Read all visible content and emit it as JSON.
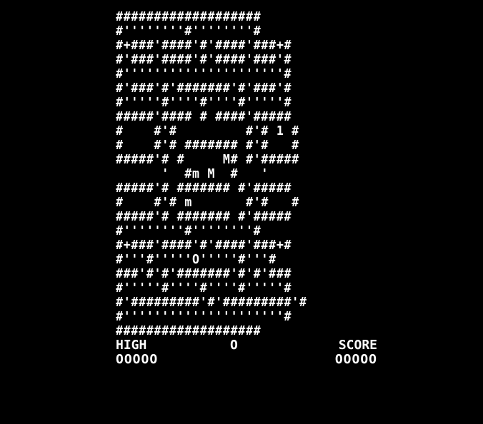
{
  "maze": {
    "rows": [
      "###################",
      "#''''''''#''''''''#",
      "#+###'####'#'####'###+#",
      "#'###'####'#'####'###'#",
      "#'''''''''''''''''''''#",
      "#'###'#'#######'#'###'#",
      "#'''''#''''#''''#'''''#",
      "#####'#### # ####'#####",
      "#    #'#         #'# 1 #",
      "#    #'# ####### #'#   #",
      "#####'# #     M# #'#####",
      "      '  #m M  #   '   ",
      "#####'# ####### #'#####",
      "#    #'# m       #'#   #",
      "#####'# ####### #'#####",
      "#''''''''#''''''''#",
      "#+###'####'#'####'###+#",
      "#'''#'''''O'''''#'''#",
      "###'#'#'#######'#'#'###",
      "#'''''#''''#''''#'''''#",
      "#'#########'#'#########'#",
      "#'''''''''''''''''''''#",
      "###################"
    ]
  },
  "hud": {
    "high_label": "HIGH",
    "lives": "O",
    "score_label": "SCORE",
    "high_value": "OOOOO",
    "score_value": "OOOOO"
  }
}
